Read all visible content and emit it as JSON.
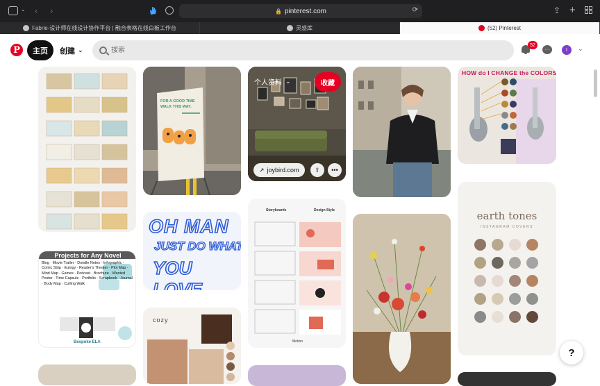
{
  "browser": {
    "url": "pinterest.com",
    "tabs": [
      {
        "label": "Fabrie-设计师在线设计协作平台 | 融合表格在线白板工作台",
        "active": false
      },
      {
        "label": "灵感库",
        "active": false
      },
      {
        "label": "(52) Pinterest",
        "active": true
      }
    ]
  },
  "header": {
    "logo": "P",
    "home_label": "主页",
    "create_label": "创建",
    "search_placeholder": "搜索",
    "notification_count": "52",
    "avatar_initial": "I"
  },
  "pins": {
    "hover_pin": {
      "board_label": "个人资料",
      "save_label": "收藏",
      "link_label": "joybird.com"
    },
    "poster_sign": {
      "line1": "FOR A GOOD TIME",
      "line2": "WALK THIS WAY."
    },
    "oh_man": {
      "line1": "OH MAN",
      "line2": "JUST DO WHAT",
      "line3": "YOU LOVE"
    },
    "storyboard": {
      "left_title": "Storyboards",
      "right_title": "Design Style",
      "footer": "Motion"
    },
    "projects": {
      "title": "Projects for Any Novel",
      "items": [
        "Blog",
        "Movie Trailer",
        "Doodle Notes",
        "Infographic",
        "Comic Strip",
        "Eulogy",
        "Reader's Theater",
        "Plot Map",
        "Mind Map",
        "Games",
        "Podcast",
        "Brochure",
        "Wanted Poster",
        "Time Capsule",
        "Portfolio",
        "Scrapbook",
        "Journal",
        "Body Map",
        "Culling Walk"
      ],
      "brand": "Bespoke ELA"
    },
    "colors_spoon": {
      "title": "HOW do I CHANGE the COLORS"
    },
    "earth_tones": {
      "title": "earth tones",
      "subtitle": "INSTAGRAM COVERS",
      "swatches": [
        "#8f7564",
        "#b8a88e",
        "#e6dad2",
        "#b58563",
        "#b0a283",
        "#6d675e",
        "#a9a6a2",
        "#a4a4a4",
        "#c7b9ad",
        "#e6dad2",
        "#a28679",
        "#b58563",
        "#b0a283",
        "#d8c9b3",
        "#9a9d9c",
        "#8f918c",
        "#8a8a8a",
        "#e7dfd5",
        "#8a7468",
        "#63493c"
      ]
    },
    "cozy": {
      "title": "cozy"
    }
  },
  "help_label": "?"
}
